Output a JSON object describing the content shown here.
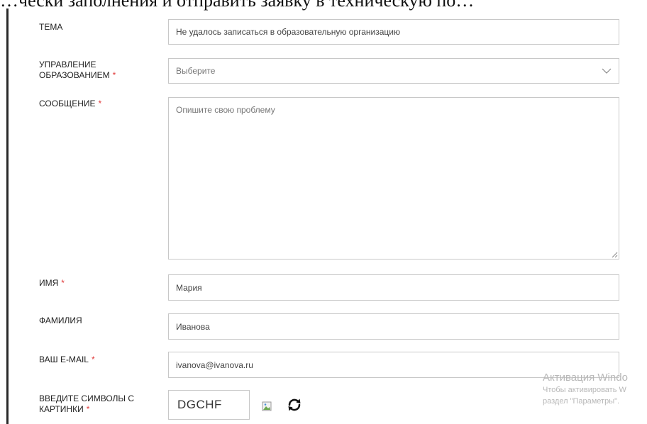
{
  "header": {
    "text": "…чески заполнения и отправить заявку в техническую по…"
  },
  "form": {
    "subject": {
      "label": "ТЕМА",
      "value": "Не удалось записаться в образовательную организацию"
    },
    "department": {
      "label": "УПРАВЛЕНИЕ ОБРАЗОВАНИЕМ",
      "placeholder": "Выберите",
      "required_mark": "*"
    },
    "message": {
      "label": "СООБЩЕНИЕ",
      "placeholder": "Опишите свою проблему",
      "required_mark": "*"
    },
    "first_name": {
      "label": "ИМЯ",
      "value": "Мария",
      "required_mark": "*"
    },
    "last_name": {
      "label": "ФАМИЛИЯ",
      "value": "Иванова"
    },
    "email": {
      "label": "ВАШ E-MAIL",
      "value": "ivanova@ivanova.ru",
      "required_mark": "*"
    },
    "captcha": {
      "label_line1": "ВВЕДИТЕ СИМВОЛЫ С",
      "label_line2": "КАРТИНКИ",
      "value": "DGCHF",
      "required_mark": "*"
    }
  },
  "icons": {
    "select_chevron": "chevron-down-icon",
    "captcha_image": "broken-image-icon",
    "refresh": "refresh-icon",
    "resize": "resize-handle-icon"
  },
  "colors": {
    "required": "#e03a3a",
    "border": "#c8c8c8"
  },
  "watermark": {
    "title": "Активация Windo",
    "line1": "Чтобы активировать W",
    "line2": "раздел \"Параметры\"."
  }
}
